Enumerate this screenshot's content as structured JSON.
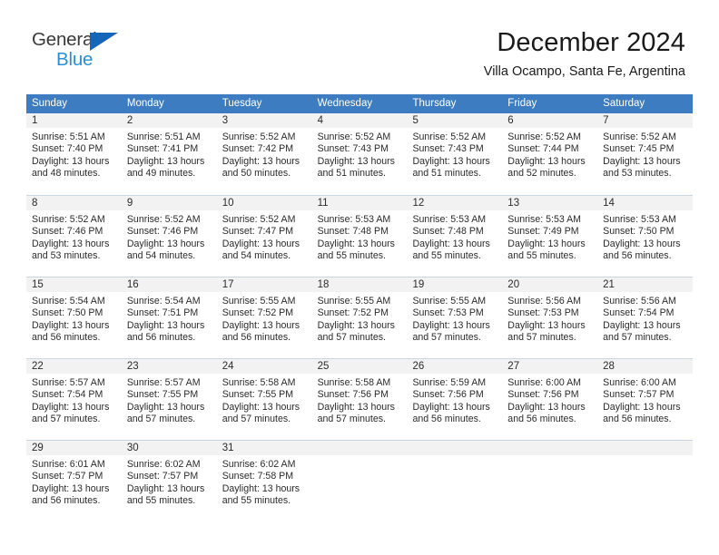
{
  "brand": {
    "name_top": "General",
    "name_bottom": "Blue",
    "color_dark": "#3a3a3a",
    "color_blue": "#2a8fd6",
    "triangle_color": "#1565b8"
  },
  "header": {
    "title": "December 2024",
    "subtitle": "Villa Ocampo, Santa Fe, Argentina"
  },
  "theme": {
    "header_bg": "#3d7cc0",
    "header_text": "#ffffff",
    "day_band_bg": "#f2f2f2",
    "row_divider": "#c9d6e4",
    "body_text": "#2b2b2b"
  },
  "weekdays": [
    "Sunday",
    "Monday",
    "Tuesday",
    "Wednesday",
    "Thursday",
    "Friday",
    "Saturday"
  ],
  "weeks": [
    [
      {
        "day": "1",
        "sunrise": "Sunrise: 5:51 AM",
        "sunset": "Sunset: 7:40 PM",
        "daylight1": "Daylight: 13 hours",
        "daylight2": "and 48 minutes."
      },
      {
        "day": "2",
        "sunrise": "Sunrise: 5:51 AM",
        "sunset": "Sunset: 7:41 PM",
        "daylight1": "Daylight: 13 hours",
        "daylight2": "and 49 minutes."
      },
      {
        "day": "3",
        "sunrise": "Sunrise: 5:52 AM",
        "sunset": "Sunset: 7:42 PM",
        "daylight1": "Daylight: 13 hours",
        "daylight2": "and 50 minutes."
      },
      {
        "day": "4",
        "sunrise": "Sunrise: 5:52 AM",
        "sunset": "Sunset: 7:43 PM",
        "daylight1": "Daylight: 13 hours",
        "daylight2": "and 51 minutes."
      },
      {
        "day": "5",
        "sunrise": "Sunrise: 5:52 AM",
        "sunset": "Sunset: 7:43 PM",
        "daylight1": "Daylight: 13 hours",
        "daylight2": "and 51 minutes."
      },
      {
        "day": "6",
        "sunrise": "Sunrise: 5:52 AM",
        "sunset": "Sunset: 7:44 PM",
        "daylight1": "Daylight: 13 hours",
        "daylight2": "and 52 minutes."
      },
      {
        "day": "7",
        "sunrise": "Sunrise: 5:52 AM",
        "sunset": "Sunset: 7:45 PM",
        "daylight1": "Daylight: 13 hours",
        "daylight2": "and 53 minutes."
      }
    ],
    [
      {
        "day": "8",
        "sunrise": "Sunrise: 5:52 AM",
        "sunset": "Sunset: 7:46 PM",
        "daylight1": "Daylight: 13 hours",
        "daylight2": "and 53 minutes."
      },
      {
        "day": "9",
        "sunrise": "Sunrise: 5:52 AM",
        "sunset": "Sunset: 7:46 PM",
        "daylight1": "Daylight: 13 hours",
        "daylight2": "and 54 minutes."
      },
      {
        "day": "10",
        "sunrise": "Sunrise: 5:52 AM",
        "sunset": "Sunset: 7:47 PM",
        "daylight1": "Daylight: 13 hours",
        "daylight2": "and 54 minutes."
      },
      {
        "day": "11",
        "sunrise": "Sunrise: 5:53 AM",
        "sunset": "Sunset: 7:48 PM",
        "daylight1": "Daylight: 13 hours",
        "daylight2": "and 55 minutes."
      },
      {
        "day": "12",
        "sunrise": "Sunrise: 5:53 AM",
        "sunset": "Sunset: 7:48 PM",
        "daylight1": "Daylight: 13 hours",
        "daylight2": "and 55 minutes."
      },
      {
        "day": "13",
        "sunrise": "Sunrise: 5:53 AM",
        "sunset": "Sunset: 7:49 PM",
        "daylight1": "Daylight: 13 hours",
        "daylight2": "and 55 minutes."
      },
      {
        "day": "14",
        "sunrise": "Sunrise: 5:53 AM",
        "sunset": "Sunset: 7:50 PM",
        "daylight1": "Daylight: 13 hours",
        "daylight2": "and 56 minutes."
      }
    ],
    [
      {
        "day": "15",
        "sunrise": "Sunrise: 5:54 AM",
        "sunset": "Sunset: 7:50 PM",
        "daylight1": "Daylight: 13 hours",
        "daylight2": "and 56 minutes."
      },
      {
        "day": "16",
        "sunrise": "Sunrise: 5:54 AM",
        "sunset": "Sunset: 7:51 PM",
        "daylight1": "Daylight: 13 hours",
        "daylight2": "and 56 minutes."
      },
      {
        "day": "17",
        "sunrise": "Sunrise: 5:55 AM",
        "sunset": "Sunset: 7:52 PM",
        "daylight1": "Daylight: 13 hours",
        "daylight2": "and 56 minutes."
      },
      {
        "day": "18",
        "sunrise": "Sunrise: 5:55 AM",
        "sunset": "Sunset: 7:52 PM",
        "daylight1": "Daylight: 13 hours",
        "daylight2": "and 57 minutes."
      },
      {
        "day": "19",
        "sunrise": "Sunrise: 5:55 AM",
        "sunset": "Sunset: 7:53 PM",
        "daylight1": "Daylight: 13 hours",
        "daylight2": "and 57 minutes."
      },
      {
        "day": "20",
        "sunrise": "Sunrise: 5:56 AM",
        "sunset": "Sunset: 7:53 PM",
        "daylight1": "Daylight: 13 hours",
        "daylight2": "and 57 minutes."
      },
      {
        "day": "21",
        "sunrise": "Sunrise: 5:56 AM",
        "sunset": "Sunset: 7:54 PM",
        "daylight1": "Daylight: 13 hours",
        "daylight2": "and 57 minutes."
      }
    ],
    [
      {
        "day": "22",
        "sunrise": "Sunrise: 5:57 AM",
        "sunset": "Sunset: 7:54 PM",
        "daylight1": "Daylight: 13 hours",
        "daylight2": "and 57 minutes."
      },
      {
        "day": "23",
        "sunrise": "Sunrise: 5:57 AM",
        "sunset": "Sunset: 7:55 PM",
        "daylight1": "Daylight: 13 hours",
        "daylight2": "and 57 minutes."
      },
      {
        "day": "24",
        "sunrise": "Sunrise: 5:58 AM",
        "sunset": "Sunset: 7:55 PM",
        "daylight1": "Daylight: 13 hours",
        "daylight2": "and 57 minutes."
      },
      {
        "day": "25",
        "sunrise": "Sunrise: 5:58 AM",
        "sunset": "Sunset: 7:56 PM",
        "daylight1": "Daylight: 13 hours",
        "daylight2": "and 57 minutes."
      },
      {
        "day": "26",
        "sunrise": "Sunrise: 5:59 AM",
        "sunset": "Sunset: 7:56 PM",
        "daylight1": "Daylight: 13 hours",
        "daylight2": "and 56 minutes."
      },
      {
        "day": "27",
        "sunrise": "Sunrise: 6:00 AM",
        "sunset": "Sunset: 7:56 PM",
        "daylight1": "Daylight: 13 hours",
        "daylight2": "and 56 minutes."
      },
      {
        "day": "28",
        "sunrise": "Sunrise: 6:00 AM",
        "sunset": "Sunset: 7:57 PM",
        "daylight1": "Daylight: 13 hours",
        "daylight2": "and 56 minutes."
      }
    ],
    [
      {
        "day": "29",
        "sunrise": "Sunrise: 6:01 AM",
        "sunset": "Sunset: 7:57 PM",
        "daylight1": "Daylight: 13 hours",
        "daylight2": "and 56 minutes."
      },
      {
        "day": "30",
        "sunrise": "Sunrise: 6:02 AM",
        "sunset": "Sunset: 7:57 PM",
        "daylight1": "Daylight: 13 hours",
        "daylight2": "and 55 minutes."
      },
      {
        "day": "31",
        "sunrise": "Sunrise: 6:02 AM",
        "sunset": "Sunset: 7:58 PM",
        "daylight1": "Daylight: 13 hours",
        "daylight2": "and 55 minutes."
      },
      {
        "day": "",
        "sunrise": "",
        "sunset": "",
        "daylight1": "",
        "daylight2": ""
      },
      {
        "day": "",
        "sunrise": "",
        "sunset": "",
        "daylight1": "",
        "daylight2": ""
      },
      {
        "day": "",
        "sunrise": "",
        "sunset": "",
        "daylight1": "",
        "daylight2": ""
      },
      {
        "day": "",
        "sunrise": "",
        "sunset": "",
        "daylight1": "",
        "daylight2": ""
      }
    ]
  ]
}
